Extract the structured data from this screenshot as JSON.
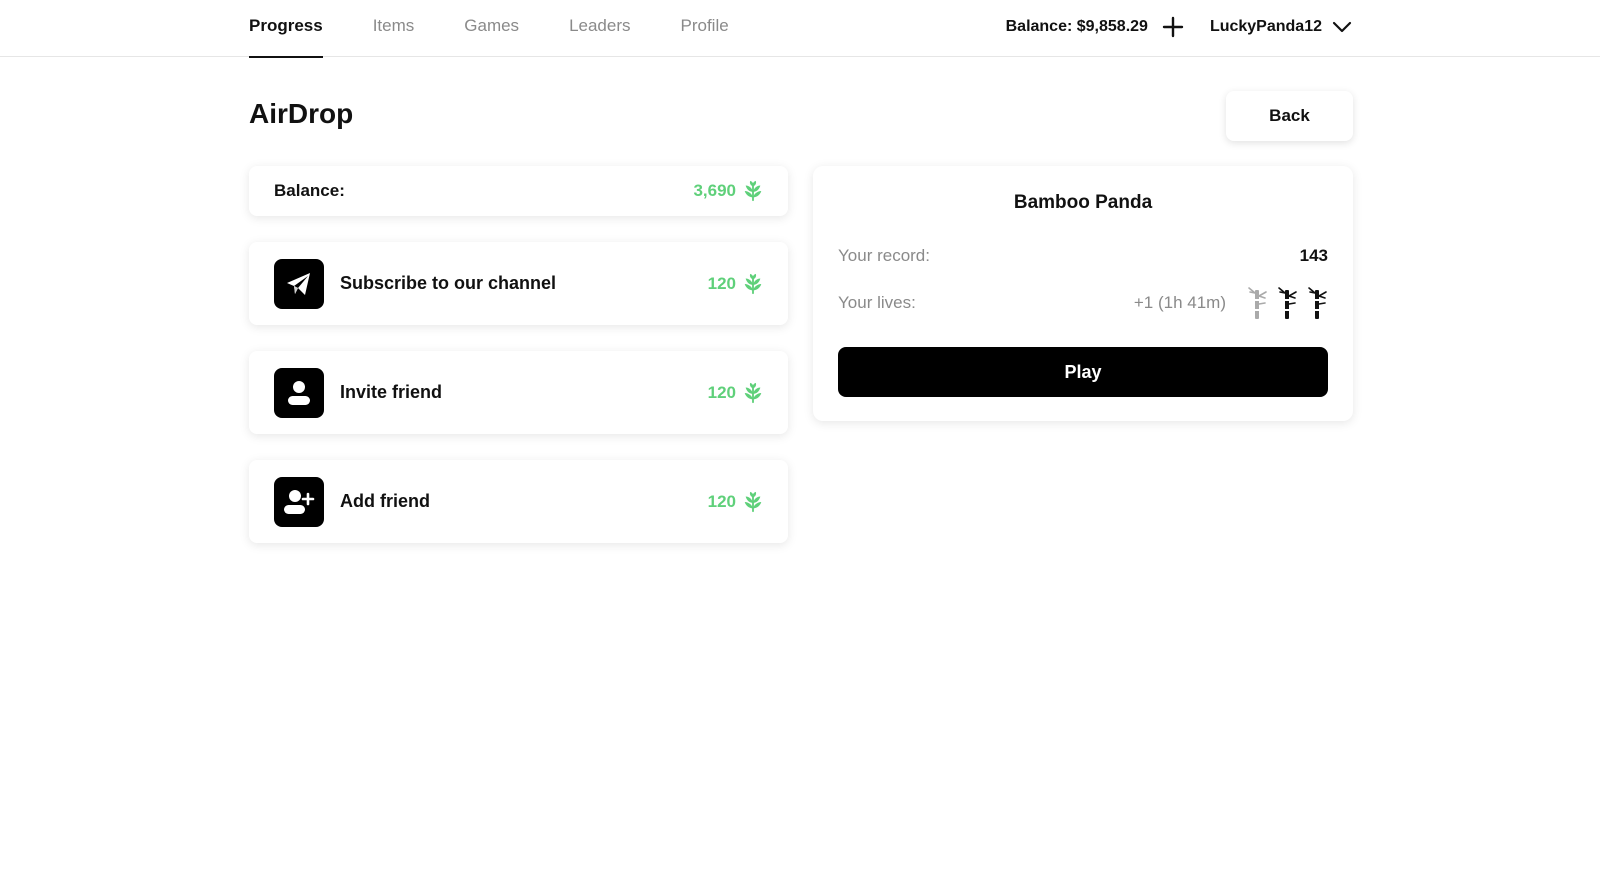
{
  "nav": {
    "items": [
      {
        "label": "Progress",
        "active": true
      },
      {
        "label": "Items",
        "active": false
      },
      {
        "label": "Games",
        "active": false
      },
      {
        "label": "Leaders",
        "active": false
      },
      {
        "label": "Profile",
        "active": false
      }
    ]
  },
  "header": {
    "balance": "Balance: $9,858.29",
    "username": "LuckyPanda12",
    "icons": {
      "add": "plus-icon",
      "menu": "chevron-down-icon"
    }
  },
  "page": {
    "title": "AirDrop",
    "back_label": "Back"
  },
  "balance_card": {
    "label": "Balance:",
    "value": "3,690",
    "icon": "leaf-icon"
  },
  "tasks": [
    {
      "label": "Subscribe to our channel",
      "reward": "120",
      "icon": "telegram-icon"
    },
    {
      "label": "Invite friend",
      "reward": "120",
      "icon": "user-icon"
    },
    {
      "label": "Add friend",
      "reward": "120",
      "icon": "user-plus-icon"
    }
  ],
  "game": {
    "title": "Bamboo Panda",
    "record_label": "Your record:",
    "record_value": "143",
    "lives_label": "Your lives:",
    "lives_timer": "+1 (1h 41m)",
    "lives_total": 3,
    "lives_filled": 2,
    "play_label": "Play"
  },
  "colors": {
    "accent_green": "#5fd07a",
    "primary": "#000000",
    "muted": "#8a8a8a"
  }
}
